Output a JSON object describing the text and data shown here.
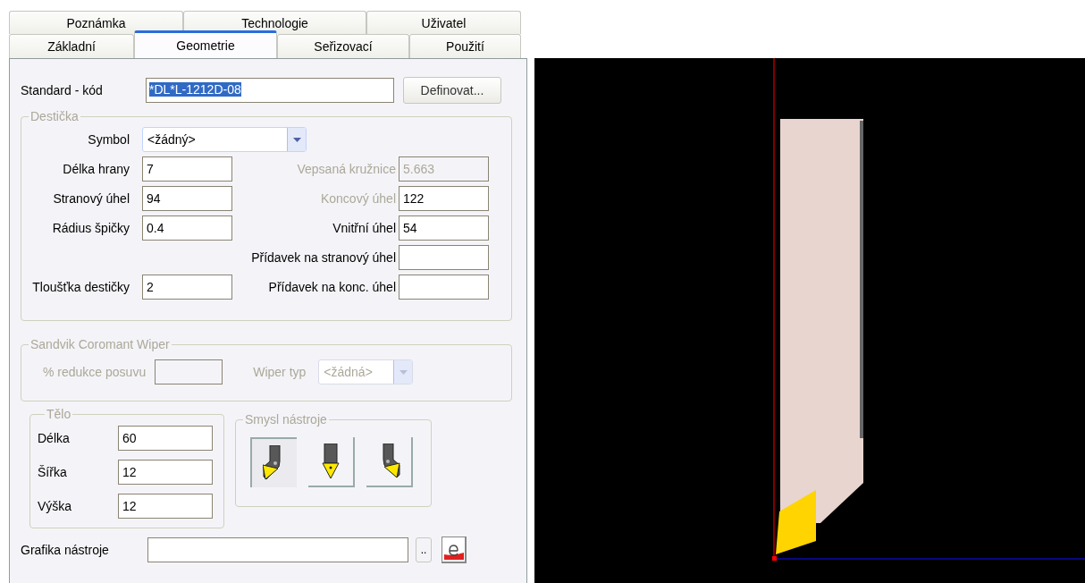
{
  "tab_rows": [
    [
      {
        "label": "Poznámka",
        "selected": false
      },
      {
        "label": "Technologie",
        "selected": false
      },
      {
        "label": "Uživatel",
        "selected": false
      }
    ],
    [
      {
        "label": "Základní",
        "selected": false
      },
      {
        "label": "Geometrie",
        "selected": true
      },
      {
        "label": "Seřizovací",
        "selected": false
      },
      {
        "label": "Použití",
        "selected": false
      }
    ]
  ],
  "standard_code": {
    "label": "Standard - kód",
    "value": "*DL*L-1212D-08",
    "text_selected": true,
    "button": "Definovat..."
  },
  "insert_group": {
    "title": "Destička",
    "symbol": {
      "label": "Symbol",
      "value": "<žádný>"
    },
    "rows": [
      {
        "left": {
          "label": "Délka hrany",
          "value": "7"
        },
        "right": {
          "label": "Vepsaná kružnice",
          "value": "5.663",
          "label_disabled": true,
          "value_disabled": true
        }
      },
      {
        "left": {
          "label": "Stranový úhel",
          "value": "94"
        },
        "right": {
          "label": "Koncový úhel",
          "value": "122",
          "label_disabled": true,
          "value_disabled": false
        }
      },
      {
        "left": {
          "label": "Rádius špičky",
          "value": "0.4"
        },
        "right": {
          "label": "Vnitřní úhel",
          "value": "54",
          "label_disabled": false,
          "value_disabled": false
        }
      },
      {
        "right": {
          "label": "Přídavek na stranový úhel",
          "label_disabled": false
        }
      },
      {
        "left": {
          "label": "Tloušťka destičky",
          "value": "2"
        },
        "right": {
          "label": "Přídavek na konc. úhel",
          "label_disabled": false
        }
      }
    ]
  },
  "wiper_group": {
    "title": "Sandvik Coromant Wiper",
    "disabled": true,
    "feed_label": "% redukce posuvu",
    "type_label": "Wiper typ",
    "type_value": "<žádná>"
  },
  "body_group": {
    "title": "Tělo",
    "fields": [
      {
        "label": "Délka",
        "value": "60"
      },
      {
        "label": "Šířka",
        "value": "12"
      },
      {
        "label": "Výška",
        "value": "12"
      }
    ]
  },
  "orientation_group": {
    "title": "Smysl nástroje",
    "buttons": [
      {
        "kind": "left",
        "selected": true
      },
      {
        "kind": "neutral",
        "selected": false
      },
      {
        "kind": "right",
        "selected": false
      }
    ]
  },
  "graphics": {
    "label": "Grafika nástroje",
    "browse": ".."
  }
}
